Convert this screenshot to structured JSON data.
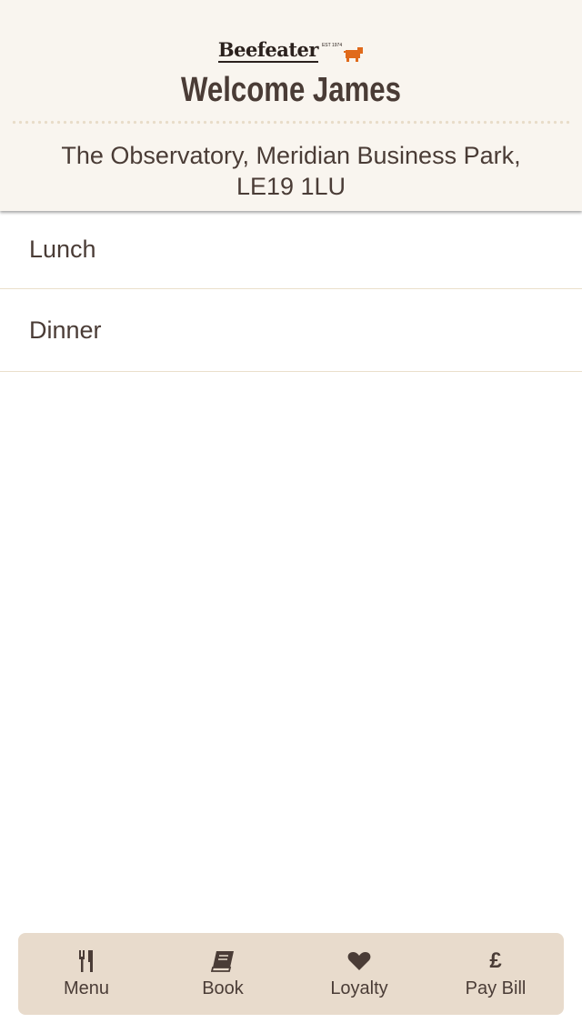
{
  "header": {
    "logo_text": "Beefeater",
    "logo_est": "EST 1974",
    "welcome": "Welcome James",
    "address": "The Observatory, Meridian Business Park, LE19 1LU"
  },
  "menu_list": [
    {
      "label": "Lunch"
    },
    {
      "label": "Dinner"
    }
  ],
  "tabbar": {
    "tabs": [
      {
        "label": "Menu",
        "icon": "cutlery-icon"
      },
      {
        "label": "Book",
        "icon": "book-icon"
      },
      {
        "label": "Loyalty",
        "icon": "heart-icon"
      },
      {
        "label": "Pay Bill",
        "icon": "pound-icon",
        "glyph": "£"
      }
    ]
  },
  "colors": {
    "header_bg": "#f9f5ef",
    "tabbar_bg": "#e8dbcc",
    "text": "#4a3c36",
    "brand_orange": "#e06a1b"
  }
}
